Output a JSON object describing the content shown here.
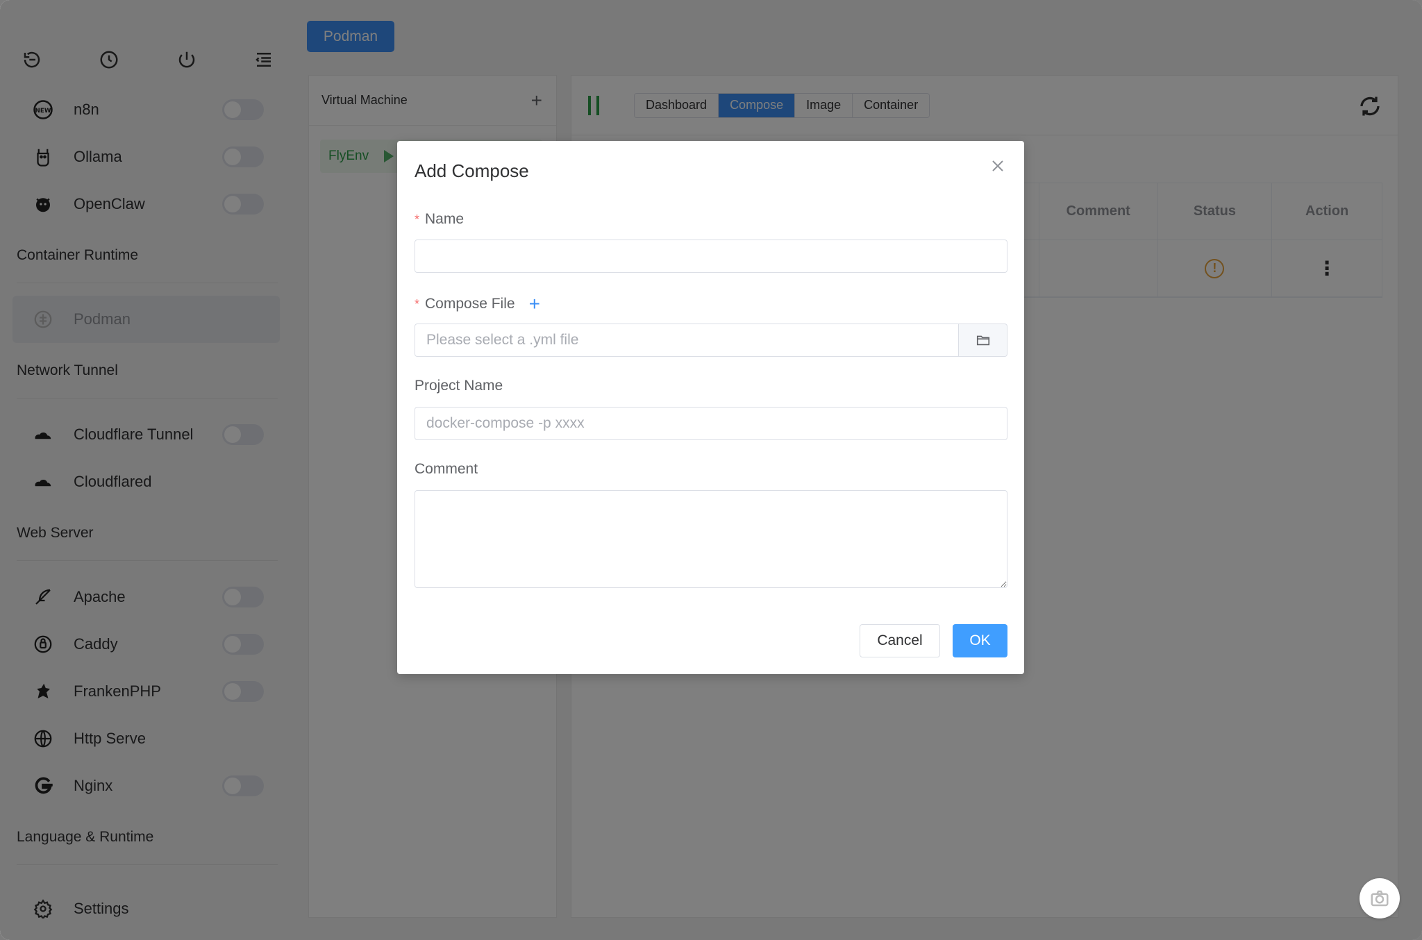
{
  "sidebar": {
    "top_icons": [
      "undo-icon",
      "history-icon",
      "power-icon",
      "menu-fold-icon"
    ],
    "items_top": [
      {
        "label": "n8n",
        "icon": "n8n-icon",
        "toggle": "off"
      },
      {
        "label": "Ollama",
        "icon": "llama-icon",
        "toggle": "off"
      },
      {
        "label": "OpenClaw",
        "icon": "openclaw-icon",
        "toggle": "off"
      }
    ],
    "groups": {
      "container_runtime": "Container Runtime",
      "network_tunnel": "Network Tunnel",
      "web_server": "Web Server",
      "language_runtime": "Language & Runtime"
    },
    "container_items": [
      {
        "label": "Podman",
        "icon": "podman-icon",
        "active": true
      }
    ],
    "tunnel_items": [
      {
        "label": "Cloudflare Tunnel",
        "icon": "cloudflare-icon",
        "toggle": "off"
      },
      {
        "label": "Cloudflared",
        "icon": "cloudflare-icon"
      }
    ],
    "web_items": [
      {
        "label": "Apache",
        "icon": "feather-icon",
        "toggle": "off"
      },
      {
        "label": "Caddy",
        "icon": "caddy-icon",
        "toggle": "off"
      },
      {
        "label": "FrankenPHP",
        "icon": "frankenphp-icon",
        "toggle": "off"
      },
      {
        "label": "Http Serve",
        "icon": "globe-icon"
      },
      {
        "label": "Nginx",
        "icon": "nginx-icon",
        "toggle": "off"
      }
    ],
    "settings_label": "Settings"
  },
  "header": {
    "podman_button": "Podman"
  },
  "vm_panel": {
    "title": "Virtual Machine",
    "rows": [
      {
        "name": "FlyEnv"
      }
    ]
  },
  "main": {
    "tabs": [
      {
        "label": "Dashboard",
        "active": false
      },
      {
        "label": "Compose",
        "active": true
      },
      {
        "label": "Image",
        "active": false
      },
      {
        "label": "Container",
        "active": false
      }
    ],
    "table": {
      "columns": [
        "Comment",
        "Status",
        "Action"
      ]
    }
  },
  "dialog": {
    "title": "Add Compose",
    "name_label": "Name",
    "name_value": "",
    "compose_file_label": "Compose File",
    "compose_file_placeholder": "Please select a .yml file",
    "project_name_label": "Project Name",
    "project_name_placeholder": "docker-compose -p xxxx",
    "comment_label": "Comment",
    "comment_value": "",
    "cancel_label": "Cancel",
    "ok_label": "OK",
    "required_mark": "*"
  },
  "colors": {
    "accent": "#409eff",
    "tab_active": "#3c8ff5",
    "running_green": "#2a9d47",
    "warning": "#e6a23c",
    "required": "#f56c6c"
  }
}
